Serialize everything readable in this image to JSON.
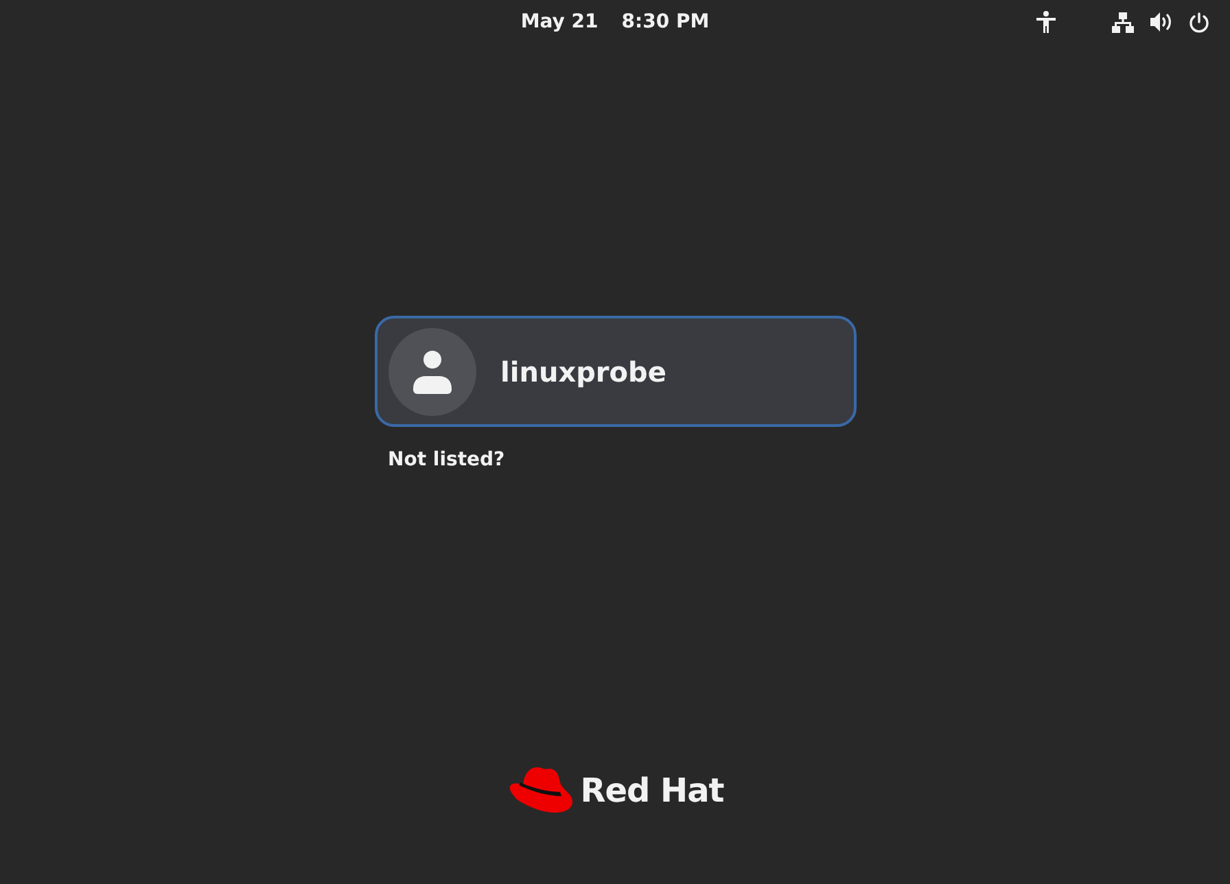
{
  "top_bar": {
    "date": "May 21",
    "time": "8:30 PM"
  },
  "users": [
    {
      "name": "linuxprobe",
      "selected": true
    }
  ],
  "not_listed": "Not listed?",
  "logo": {
    "text": "Red Hat"
  }
}
